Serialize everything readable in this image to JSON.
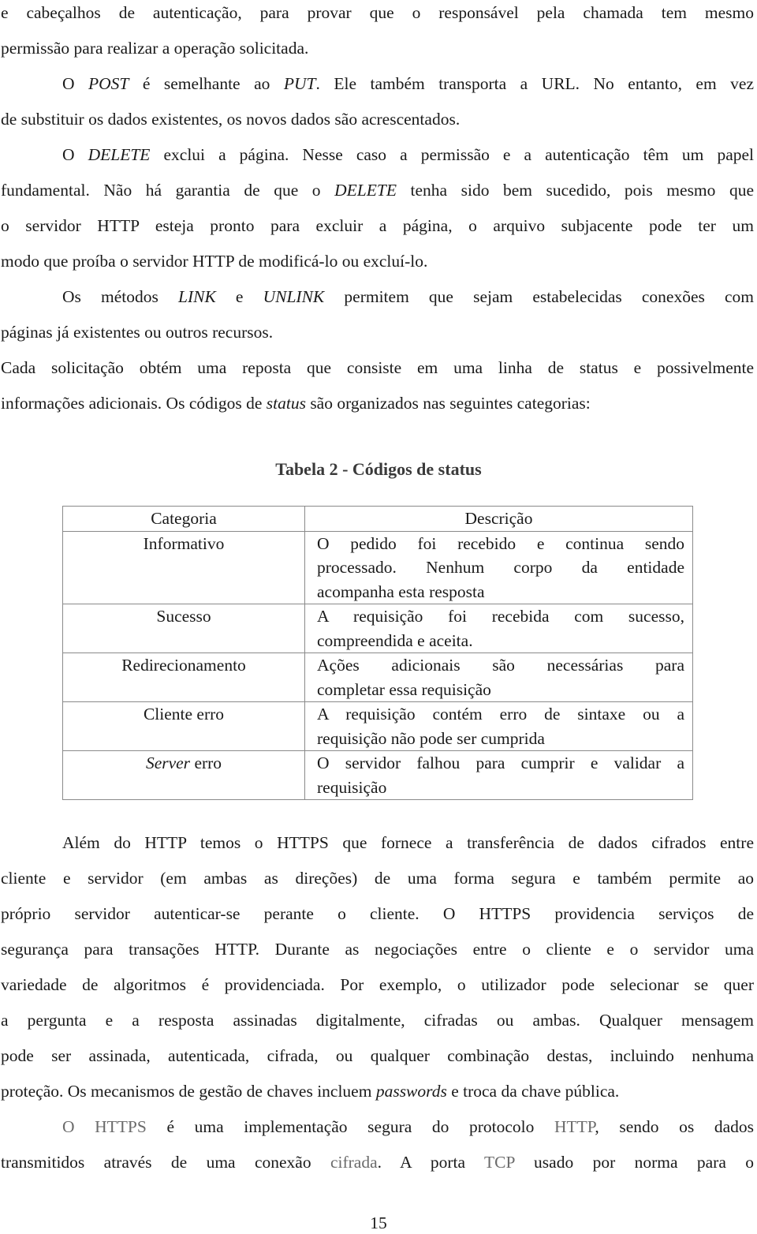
{
  "document": {
    "paragraphs_before_table": [
      {
        "id": "p1",
        "lines": [
          "e cabeçalhos de autenticação, para provar que o responsável pela chamada tem mesmo",
          "permissão para realizar a operação solicitada."
        ]
      },
      {
        "id": "p2",
        "segments_line1": [
          "O ",
          "POST",
          " é semelhante ao ",
          "PUT",
          ". Ele também transporta a URL. No entanto, em vez"
        ],
        "line2": "de substituir os dados existentes, os novos dados são acrescentados."
      },
      {
        "id": "p3",
        "segments_line1": [
          "O ",
          "DELETE",
          " exclui a página. Nesse caso a permissão e a autenticação têm um papel"
        ],
        "segments_line2": [
          "fundamental. Não há garantia de que o ",
          "DELETE",
          " tenha sido bem sucedido, pois mesmo que"
        ],
        "line3": "o servidor HTTP esteja pronto para excluir a página, o arquivo subjacente pode ter um",
        "line4": "modo que proíba o servidor HTTP de modificá-lo ou excluí-lo."
      },
      {
        "id": "p4",
        "segments_line1": [
          "Os métodos ",
          "LINK",
          " e ",
          "UNLINK",
          " permitem que sejam estabelecidas conexões com"
        ],
        "line2": "páginas já existentes ou outros recursos."
      },
      {
        "id": "p5",
        "line1": "Cada solicitação obtém uma reposta que consiste em uma linha de status e possivelmente",
        "segments_line2": [
          "informações adicionais. Os códigos de ",
          "status",
          " são organizados nas seguintes categorias:"
        ]
      }
    ],
    "table": {
      "caption": "Tabela 2 - Códigos de status",
      "headers": [
        "Categoria",
        "Descrição"
      ],
      "rows": [
        {
          "category": "Informativo",
          "category_italic": "",
          "description_lines": [
            "O pedido foi recebido e continua sendo",
            "processado. Nenhum corpo da entidade",
            "acompanha esta resposta"
          ]
        },
        {
          "category": "Sucesso",
          "category_italic": "",
          "description_lines": [
            "A requisição foi recebida com sucesso,",
            "compreendida e aceita."
          ]
        },
        {
          "category": "Redirecionamento",
          "category_italic": "",
          "description_lines": [
            "Ações adicionais são necessárias para",
            "completar essa requisição"
          ]
        },
        {
          "category": "Cliente erro",
          "category_italic": "",
          "description_lines": [
            "A requisição contém erro de sintaxe ou a",
            "requisição não pode ser cumprida"
          ]
        },
        {
          "category": " erro",
          "category_italic": "Server",
          "description_lines": [
            "O servidor falhou para cumprir e validar a",
            "requisição"
          ]
        }
      ]
    },
    "paragraphs_after_table": {
      "p6_lines": [
        "Além do HTTP temos o HTTPS que fornece a transferência de dados cifrados entre",
        "cliente e servidor (em ambas as direções) de uma forma segura e também permite ao",
        "próprio servidor autenticar-se perante o cliente. O HTTPS providencia serviços de",
        "segurança para transações HTTP. Durante as negociações entre o cliente e o servidor uma",
        "variedade de algoritmos é providenciada. Por exemplo, o utilizador pode selecionar se quer",
        "a pergunta e a resposta assinadas digitalmente, cifradas ou ambas. Qualquer mensagem",
        "pode ser assinada, autenticada, cifrada, ou qualquer combinação destas, incluindo nenhuma"
      ],
      "p6_last_segments": [
        "proteção. Os mecanismos de gestão de chaves incluem ",
        "passwords",
        " e troca da chave pública."
      ],
      "p7_line1_segments": [
        "O HTTPS",
        " é uma implementação segura do protocolo ",
        "HTTP",
        ", sendo os dados"
      ],
      "p7_line2_segments": [
        "transmitidos através de uma conexão ",
        "cifrada",
        ". A porta ",
        "TCP",
        " usado por norma para o"
      ]
    },
    "page_number": "15",
    "colors": {
      "text": "#1a1a1a",
      "link_gray": "#6b6b6b",
      "table_border": "#8a8a8a",
      "caption": "#3a3a3a"
    }
  }
}
